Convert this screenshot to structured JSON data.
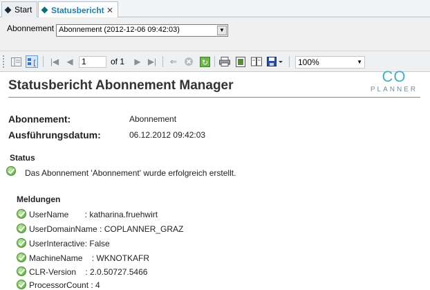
{
  "tabs": [
    {
      "label": "Start"
    },
    {
      "label": "Statusbericht",
      "close": "✕"
    }
  ],
  "filter": {
    "label": "Abonnement",
    "selected": "Abonnement (2012-12-06 09:42:03)"
  },
  "toolbar": {
    "page_current": "1",
    "page_of": "of 1",
    "zoom": "100%"
  },
  "report": {
    "title": "Statusbericht Abonnement Manager",
    "logo": {
      "top": "CO",
      "bottom": "PLANNER"
    },
    "fields": [
      {
        "label": "Abonnement:",
        "value": "Abonnement"
      },
      {
        "label": "Ausführungsdatum:",
        "value": "06.12.2012 09:42:03"
      }
    ],
    "status_heading": "Status",
    "status_text": "Das Abonnement 'Abonnement' wurde erfolgreich erstellt.",
    "messages_heading": "Meldungen",
    "messages": [
      "UserName       : katharina.fruehwirt",
      "UserDomainName : COPLANNER_GRAZ",
      "UserInteractive: False",
      "MachineName    : WKNOTKAFR",
      "CLR-Version    : 2.0.50727.5466",
      "ProcessorCount : 4"
    ]
  },
  "colors": {
    "active_tab": "#1f7fa6",
    "success": "#69b848",
    "logo": "#45b0c2"
  }
}
